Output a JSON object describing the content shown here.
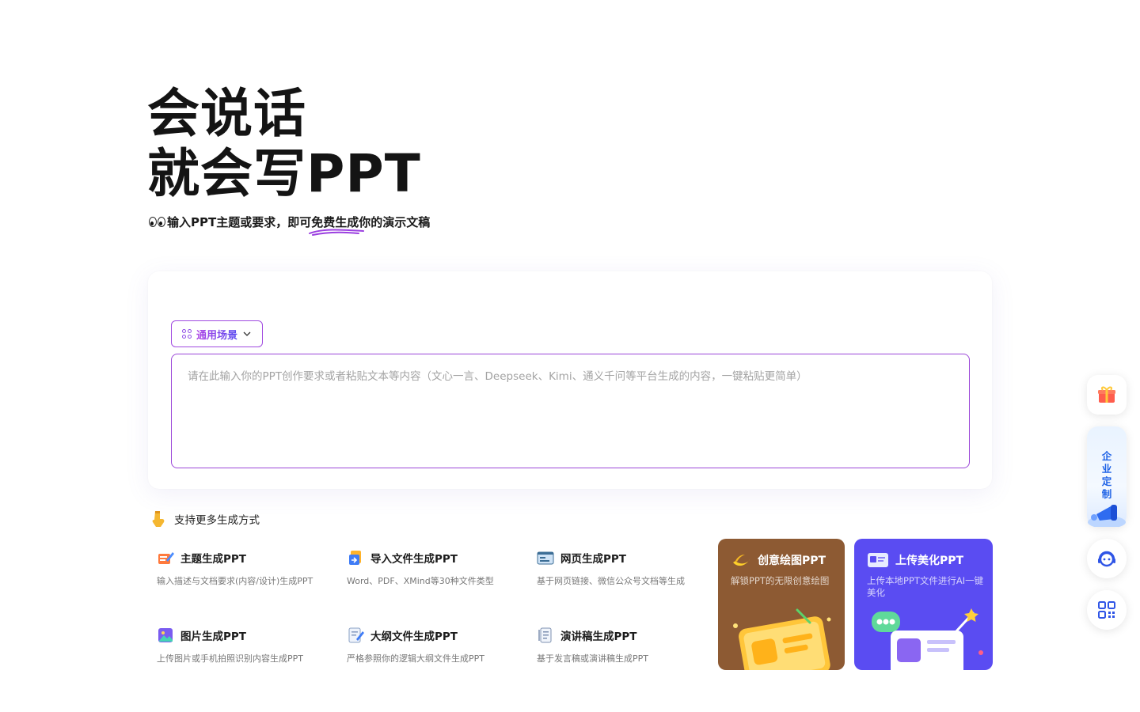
{
  "hero": {
    "line1": "会说话",
    "line2": "就会写PPT",
    "subtitle_pre": "输入PPT主题或要求，即可",
    "subtitle_hl": "免费生成",
    "subtitle_post": "你的演示文稿"
  },
  "input_card": {
    "scene_label": "通用场景",
    "placeholder": "请在此输入你的PPT创作要求或者粘贴文本等内容（文心一言、Deepseek、Kimi、通义千问等平台生成的内容，一键粘贴更简单）",
    "value": ""
  },
  "more_section": {
    "title": "支持更多生成方式"
  },
  "modes": [
    {
      "icon": "theme-pencil-icon",
      "title": "主题生成PPT",
      "desc": "输入描述与文档要求(内容/设计)生成PPT"
    },
    {
      "icon": "file-import-icon",
      "title": "导入文件生成PPT",
      "desc": "Word、PDF、XMind等30种文件类型"
    },
    {
      "icon": "webpage-icon",
      "title": "网页生成PPT",
      "desc": "基于网页链接、微信公众号文档等生成"
    },
    {
      "icon": "image-icon",
      "title": "图片生成PPT",
      "desc": "上传图片或手机拍照识别内容生成PPT"
    },
    {
      "icon": "outline-doc-icon",
      "title": "大纲文件生成PPT",
      "desc": "严格参照你的逻辑大纲文件生成PPT"
    },
    {
      "icon": "speech-doc-icon",
      "title": "演讲稿生成PPT",
      "desc": "基于发言稿或演讲稿生成PPT"
    }
  ],
  "features": [
    {
      "title": "创意绘图PPT",
      "desc": "解锁PPT的无限创意绘图",
      "color": "#8d5a33"
    },
    {
      "title": "上传美化PPT",
      "desc": "上传本地PPT文件进行AI一键美化",
      "color": "#5a4cf2"
    }
  ],
  "sidebar": {
    "enterprise_label": [
      "企",
      "业",
      "定",
      "制"
    ]
  },
  "colors": {
    "accent_purple": "#9b47d8",
    "accent_blue": "#5a4cf2",
    "brown_card": "#8d5a33"
  }
}
